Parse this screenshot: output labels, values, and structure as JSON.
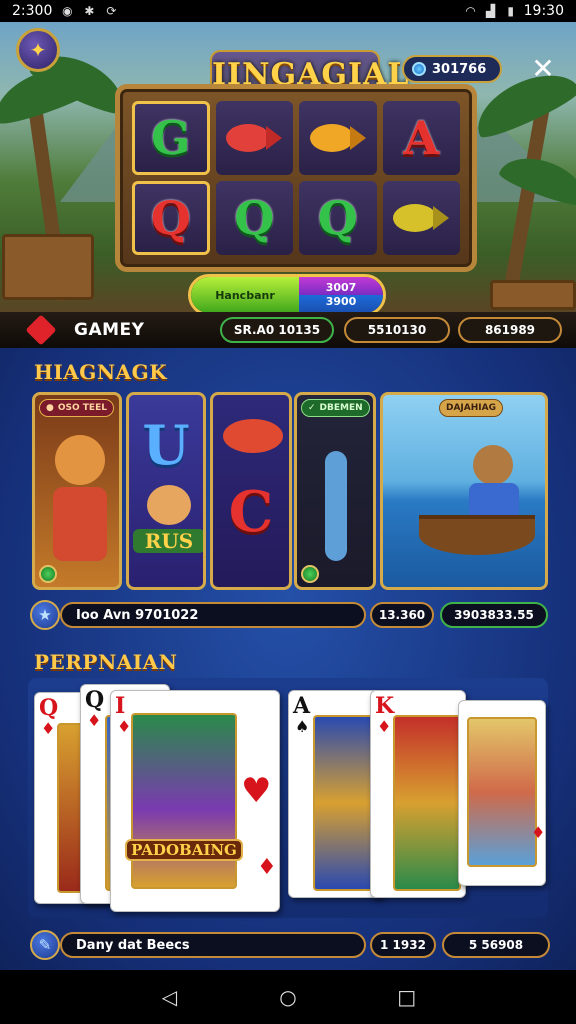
{
  "status_bar": {
    "time_left": "2:300",
    "time_right": "19:30"
  },
  "header": {
    "title": "IINGAGIAL",
    "coins": "301766",
    "close_glyph": "✕"
  },
  "reels": {
    "symbols": [
      "G",
      "fish-red",
      "fish-gold",
      "A",
      "Q",
      "Q",
      "Q",
      "fish-gold"
    ]
  },
  "spin": {
    "left_label": "Hancbanr",
    "right_top": "3007",
    "right_bottom": "3900"
  },
  "category": {
    "label": "GAMEY",
    "stats": [
      "SR.A0 10135",
      "5510130",
      "861989"
    ]
  },
  "section1": {
    "title": "HIAGNAGK",
    "tiles": [
      {
        "tag": "OSO TEEL"
      },
      {
        "letters": [
          "U",
          "RUS"
        ]
      },
      {
        "letters": [
          "C"
        ]
      },
      {
        "tag": "DBEMEN"
      },
      {
        "tag": "DAJAHIAG"
      }
    ],
    "info": {
      "text": "Ioo Avn 9701022",
      "pill1": "13.360",
      "pill2": "3903833.55"
    }
  },
  "section2": {
    "title": "PERPNAIAN",
    "cards": [
      {
        "rank": "Q",
        "suit": "♦"
      },
      {
        "rank": "Q",
        "suit": "♦"
      },
      {
        "rank": "I",
        "suit": "♦",
        "art_label": "PADOBAING"
      },
      {
        "rank": "A",
        "suit": "♠"
      },
      {
        "rank": "K",
        "suit": "♦"
      },
      {
        "rank": "",
        "suit": "♦"
      }
    ],
    "info": {
      "text": "Dany dat Beecs",
      "pill1": "1 1932",
      "pill2": "5 56908"
    }
  },
  "colors": {
    "gold": "#ffc94a",
    "blue_bg": "#16307a",
    "accent_green": "#3fb34a",
    "accent_red": "#e0232a"
  }
}
